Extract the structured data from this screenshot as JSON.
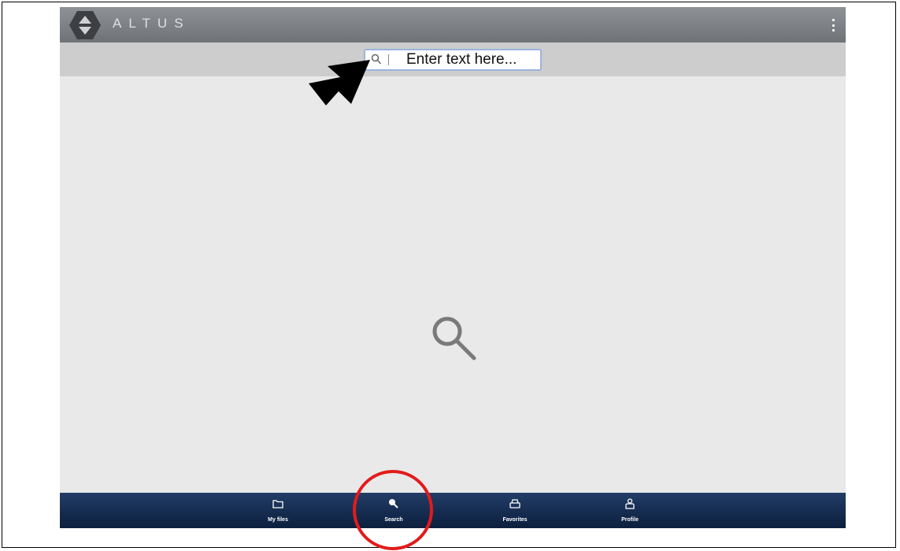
{
  "app": {
    "brand": "ALTUS"
  },
  "colors": {
    "topbar": "#7f8286",
    "searchbar": "#cdcdcd",
    "content_bg": "#e9e9e9",
    "navbar": "#15294b",
    "highlight": "#e31b1b"
  },
  "search": {
    "placeholder": "Enter text here...",
    "icon": "search-icon"
  },
  "content": {
    "icon": "search-icon"
  },
  "nav": {
    "items": [
      {
        "label": "My files",
        "icon": "folder-icon"
      },
      {
        "label": "Search",
        "icon": "search-icon",
        "active": true
      },
      {
        "label": "Favorites",
        "icon": "favorites-icon"
      },
      {
        "label": "Profile",
        "icon": "profile-icon"
      }
    ]
  },
  "annotations": {
    "arrow": "arrow-icon",
    "circle": "highlight-circle"
  }
}
